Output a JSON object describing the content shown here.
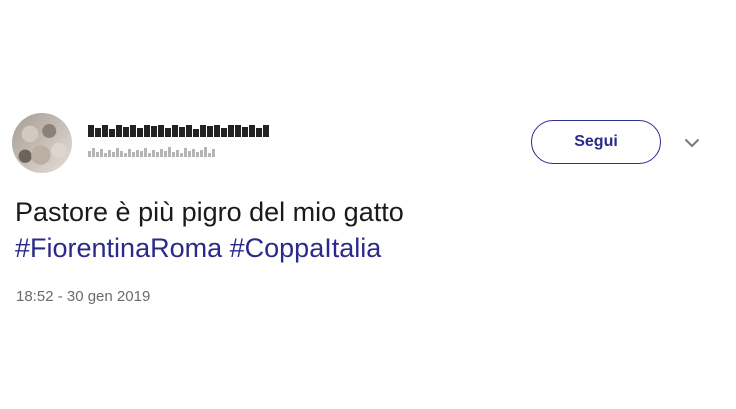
{
  "tweet": {
    "follow_label": "Segui",
    "text_line1": "Pastore è più pigro del mio gatto",
    "hashtags": [
      "#FiorentinaRoma",
      "#CoppaItalia"
    ],
    "timestamp": "18:52 - 30 gen 2019"
  },
  "icons": {
    "more": "chevron-down-icon"
  },
  "colors": {
    "link": "#2a2a8a",
    "text": "#1a1a1a",
    "muted": "#6b6b6b"
  }
}
